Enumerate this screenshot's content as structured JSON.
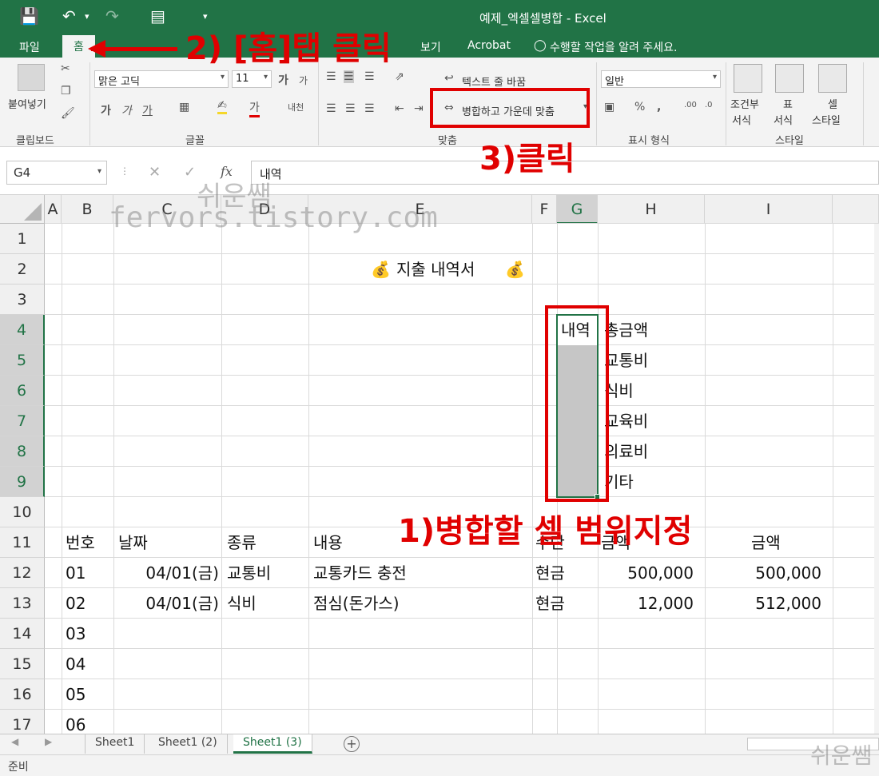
{
  "window": {
    "title": "예제_엑셀셀병합 - Excel"
  },
  "tabs": [
    {
      "label": "파일",
      "active": false
    },
    {
      "label": "홈",
      "active": true
    },
    {
      "label": "보기",
      "active": false
    },
    {
      "label": "Acrobat",
      "active": false
    }
  ],
  "tell_me": "수행할 작업을 알려 주세요.",
  "ribbon": {
    "clipboard": {
      "paste": "붙여넣기",
      "group": "클립보드"
    },
    "font": {
      "name": "맑은 고딕",
      "size": "11",
      "group": "글꼴"
    },
    "alignment": {
      "wrap_text": "텍스트 줄 바꿈",
      "merge_center": "병합하고 가운데 맞춤",
      "group": "맞춤"
    },
    "number": {
      "format": "일반",
      "group": "표시 형식"
    },
    "styles": {
      "conditional_1": "조건부",
      "conditional_2": "서식",
      "table_1": "표",
      "table_2": "서식",
      "cell_1": "셀",
      "cell_2": "스타일",
      "group": "스타일"
    }
  },
  "formula_bar": {
    "name_box": "G4",
    "fx": "fx",
    "content": "내역"
  },
  "grid": {
    "columns": [
      "A",
      "B",
      "C",
      "D",
      "E",
      "F",
      "G",
      "H",
      "I"
    ],
    "rows": [
      "1",
      "2",
      "3",
      "4",
      "5",
      "6",
      "7",
      "8",
      "9",
      "10",
      "11",
      "12",
      "13",
      "14",
      "15",
      "16",
      "17"
    ],
    "selected_column": "G",
    "title": "지출 내역서",
    "summary": {
      "header_g": "내역",
      "header_h": "총금액",
      "items": [
        "교통비",
        "식비",
        "교육비",
        "의료비",
        "기타"
      ]
    },
    "table_headers": {
      "no": "번호",
      "date": "날짜",
      "type": "종류",
      "content": "내용",
      "method": "수단",
      "amount": "금액",
      "total": "금액"
    },
    "rows_data": [
      {
        "no": "01",
        "date": "04/01(금)",
        "type": "교통비",
        "content": "교통카드 충전",
        "method": "현금",
        "amount": "500,000",
        "total": "500,000"
      },
      {
        "no": "02",
        "date": "04/01(금)",
        "type": "식비",
        "content": "점심(돈가스)",
        "method": "현금",
        "amount": "12,000",
        "total": "512,000"
      }
    ],
    "empty_numbers": [
      "03",
      "04",
      "05",
      "06"
    ]
  },
  "sheets": [
    {
      "label": "Sheet1",
      "active": false
    },
    {
      "label": "Sheet1 (2)",
      "active": false
    },
    {
      "label": "Sheet1 (3)",
      "active": true
    }
  ],
  "status": {
    "ready": "준비"
  },
  "annotations": {
    "step1": "1)병합할 셀 범위지정",
    "step2": "2) [홈]탭 클릭",
    "step3": "3)클릭"
  },
  "watermark": {
    "name": "쉬운쌤",
    "url": "fervors.tistory.com"
  },
  "colors": {
    "excel_green": "#217346",
    "annotation_red": "#e00000",
    "selection_fill": "#c6c6c6"
  }
}
